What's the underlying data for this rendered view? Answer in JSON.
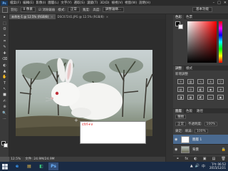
{
  "app": {
    "logo": "Ps"
  },
  "menubar": {
    "items": [
      "檔案(F)",
      "編輯(E)",
      "影像(I)",
      "圖層(L)",
      "文字(Y)",
      "選取(S)",
      "濾鏡(T)",
      "3D(D)",
      "檢視(V)",
      "視窗(W)",
      "說明(H)"
    ],
    "window_controls": [
      "–",
      "□",
      "✕"
    ]
  },
  "options": {
    "feather_label": "羽化:",
    "feather_value": "0 像素",
    "antialias_label": "☑ 消除鋸齒",
    "style_label": "樣式:",
    "style_value": "正常",
    "width_label": "寬度:",
    "height_label": "高度:",
    "refine_label": "調整邊緣...",
    "workspace": "基本功能"
  },
  "tabs": [
    {
      "label": "未命名-1 @ 12.5% (RGB/8)",
      "active": true
    },
    {
      "label": "DSC07241.JPG @ 12.5% (RGB/8)",
      "active": false
    }
  ],
  "tools": [
    "▸",
    "⬚",
    "ʘ",
    "⌖",
    "⌗",
    "✎",
    "✚",
    "⌫",
    "◐",
    "▲",
    "✋",
    "T",
    "↖",
    "■",
    "✍",
    "⊕",
    "🔍",
    "⋯"
  ],
  "canvas": {
    "paste_text": "ctrl+v"
  },
  "status": {
    "zoom": "12.5%",
    "doc": "文件: 24.9M/24.9M"
  },
  "color_panel": {
    "tabs": [
      "色彩",
      "色票"
    ]
  },
  "adjust_panel": {
    "tabs": [
      "調整",
      "樣式"
    ],
    "title": "新增調整"
  },
  "layers_panel": {
    "tabs": [
      "圖層",
      "色版",
      "路徑"
    ],
    "kind_label": "種類",
    "mode": "正常",
    "opacity_label": "不透明度:",
    "opacity": "100%",
    "lock_label": "鎖定:",
    "fill_label": "填滿:",
    "fill": "100%",
    "layers": [
      {
        "name": "圖層 1",
        "selected": true
      },
      {
        "name": "背景",
        "selected": false
      }
    ],
    "footer_icons": [
      "⚭",
      "fx",
      "◐",
      "▣",
      "▤",
      "🗑"
    ]
  },
  "taskbar": {
    "apps": [
      "e",
      "▤",
      "◧",
      "Ps"
    ],
    "time": "下午 06:52",
    "date": "2015/12/21",
    "tray_icons": [
      "▲",
      "🔊",
      "中"
    ]
  },
  "colors": {
    "accent": "#4a6a90",
    "taskbar": "#1a2b44",
    "paste_text": "#e02020"
  }
}
